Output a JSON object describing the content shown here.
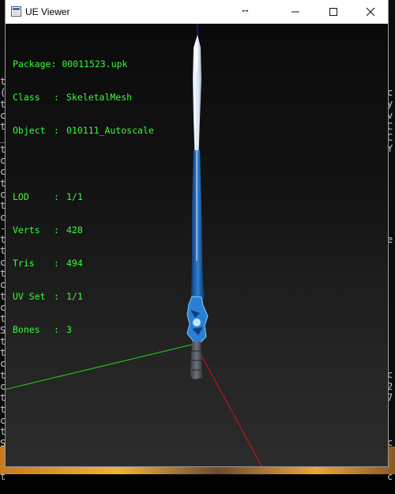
{
  "window": {
    "title": "UE Viewer",
    "icon": "app-icon",
    "resize_glyph": "↔",
    "minimize_glyph": "—",
    "maximize_glyph": "☐",
    "close_glyph": "✕"
  },
  "info": {
    "package_label": "Package:",
    "package_value": "00011523.upk",
    "class_label": "Class",
    "class_value": "SkeletalMesh",
    "object_label": "Object",
    "object_value": "010111_Autoscale",
    "lod_label": "LOD",
    "lod_value": "1/1",
    "verts_label": "Verts",
    "verts_value": "428",
    "tris_label": "Tris",
    "tris_value": "494",
    "uvset_label": "UV Set",
    "uvset_value": "1/1",
    "bones_label": "Bones",
    "bones_value": "3",
    "separator": ":"
  },
  "background_console": {
    "left_chars": [
      "t",
      "(",
      "t",
      "c",
      "t",
      "_",
      "t",
      "c",
      "c",
      "t",
      "c",
      "t",
      "c",
      "-",
      "t",
      "t",
      "c",
      "t",
      "c",
      "t",
      "c",
      "t",
      "S",
      "t",
      "t",
      "c",
      "t",
      "c",
      "t",
      "t",
      "c",
      "t",
      "S",
      "t",
      "c",
      "t"
    ],
    "right_chars": [
      "c",
      "y",
      "v",
      "C",
      "C",
      "Y",
      "",
      "",
      "",
      "",
      "",
      "",
      "",
      "e",
      "",
      "",
      "",
      "",
      "",
      "",
      "",
      "",
      "",
      "",
      "",
      "c",
      "2",
      "7",
      "",
      "",
      "",
      "c",
      "2",
      "s",
      "c",
      ""
    ]
  },
  "colors": {
    "info_text": "#33ff33",
    "axis_x": "#e01010",
    "axis_y": "#20d020",
    "axis_z": "#2020ff"
  }
}
